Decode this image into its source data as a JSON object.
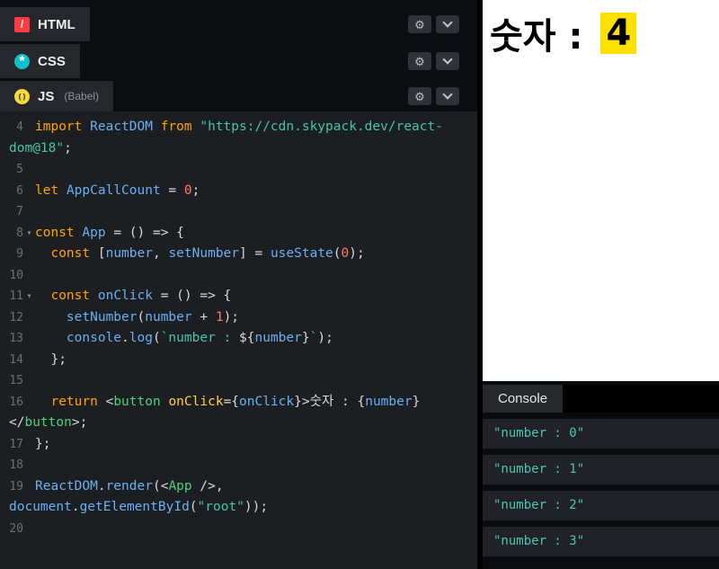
{
  "icons": {
    "gear": "⚙",
    "chevron_down": "css-shape",
    "fold_caret": "▾"
  },
  "colors": {
    "html_icon": "#ff3c41",
    "css_icon": "#13c0c9",
    "js_icon": "#f5d93b",
    "number_highlight": "#ffe000",
    "console_log_text": "#49c7b2",
    "editor_background": "#1d1e22"
  },
  "editor": {
    "panels": [
      {
        "label": "HTML",
        "glyph": "/"
      },
      {
        "label": "CSS",
        "glyph": "*"
      },
      {
        "label": "JS",
        "sublabel": "(Babel)",
        "glyph": "( )"
      }
    ],
    "code": [
      {
        "num": "4",
        "tokens": [
          {
            "t": "kw",
            "s": "import"
          },
          {
            "t": "pun",
            "s": " "
          },
          {
            "t": "var",
            "s": "ReactDOM"
          },
          {
            "t": "pun",
            "s": " "
          },
          {
            "t": "kw",
            "s": "from"
          },
          {
            "t": "pun",
            "s": " "
          },
          {
            "t": "str",
            "s": "\"https://cdn.skypack.dev/react-"
          }
        ]
      },
      {
        "num": "",
        "wrap": true,
        "tokens": [
          {
            "t": "str",
            "s": "dom@18\""
          },
          {
            "t": "pun",
            "s": ";"
          }
        ]
      },
      {
        "num": "5",
        "tokens": []
      },
      {
        "num": "6",
        "tokens": [
          {
            "t": "kw",
            "s": "let"
          },
          {
            "t": "pun",
            "s": " "
          },
          {
            "t": "var",
            "s": "AppCallCount"
          },
          {
            "t": "pun",
            "s": " = "
          },
          {
            "t": "num",
            "s": "0"
          },
          {
            "t": "pun",
            "s": ";"
          }
        ]
      },
      {
        "num": "7",
        "tokens": []
      },
      {
        "num": "8",
        "fold": true,
        "tokens": [
          {
            "t": "kw",
            "s": "const"
          },
          {
            "t": "pun",
            "s": " "
          },
          {
            "t": "var",
            "s": "App"
          },
          {
            "t": "pun",
            "s": " = () => {"
          }
        ]
      },
      {
        "num": "9",
        "tokens": [
          {
            "t": "pun",
            "s": "  "
          },
          {
            "t": "kw",
            "s": "const"
          },
          {
            "t": "pun",
            "s": " ["
          },
          {
            "t": "var",
            "s": "number"
          },
          {
            "t": "pun",
            "s": ", "
          },
          {
            "t": "var",
            "s": "setNumber"
          },
          {
            "t": "pun",
            "s": "] = "
          },
          {
            "t": "var",
            "s": "useState"
          },
          {
            "t": "pun",
            "s": "("
          },
          {
            "t": "num",
            "s": "0"
          },
          {
            "t": "pun",
            "s": ");"
          }
        ]
      },
      {
        "num": "10",
        "tokens": []
      },
      {
        "num": "11",
        "fold": true,
        "tokens": [
          {
            "t": "pun",
            "s": "  "
          },
          {
            "t": "kw",
            "s": "const"
          },
          {
            "t": "pun",
            "s": " "
          },
          {
            "t": "var",
            "s": "onClick"
          },
          {
            "t": "pun",
            "s": " = () => {"
          }
        ]
      },
      {
        "num": "12",
        "tokens": [
          {
            "t": "pun",
            "s": "    "
          },
          {
            "t": "var",
            "s": "setNumber"
          },
          {
            "t": "pun",
            "s": "("
          },
          {
            "t": "var",
            "s": "number"
          },
          {
            "t": "pun",
            "s": " + "
          },
          {
            "t": "num",
            "s": "1"
          },
          {
            "t": "pun",
            "s": ");"
          }
        ]
      },
      {
        "num": "13",
        "tokens": [
          {
            "t": "pun",
            "s": "    "
          },
          {
            "t": "var",
            "s": "console"
          },
          {
            "t": "pun",
            "s": "."
          },
          {
            "t": "var",
            "s": "log"
          },
          {
            "t": "pun",
            "s": "("
          },
          {
            "t": "str",
            "s": "`number : "
          },
          {
            "t": "pun",
            "s": "${"
          },
          {
            "t": "var",
            "s": "number"
          },
          {
            "t": "pun",
            "s": "}"
          },
          {
            "t": "str",
            "s": "`"
          },
          {
            "t": "pun",
            "s": ");"
          }
        ]
      },
      {
        "num": "14",
        "tokens": [
          {
            "t": "pun",
            "s": "  };"
          }
        ]
      },
      {
        "num": "15",
        "tokens": []
      },
      {
        "num": "16",
        "tokens": [
          {
            "t": "pun",
            "s": "  "
          },
          {
            "t": "kw",
            "s": "return"
          },
          {
            "t": "pun",
            "s": " <"
          },
          {
            "t": "tag",
            "s": "button"
          },
          {
            "t": "pun",
            "s": " "
          },
          {
            "t": "attr",
            "s": "onClick"
          },
          {
            "t": "pun",
            "s": "={"
          },
          {
            "t": "var",
            "s": "onClick"
          },
          {
            "t": "pun",
            "s": "}>"
          },
          {
            "t": "pun",
            "s": "숫자 : {"
          },
          {
            "t": "var",
            "s": "number"
          },
          {
            "t": "pun",
            "s": "}"
          }
        ]
      },
      {
        "num": "",
        "wrap": true,
        "tokens": [
          {
            "t": "pun",
            "s": "</"
          },
          {
            "t": "tag",
            "s": "button"
          },
          {
            "t": "pun",
            "s": ">;"
          }
        ]
      },
      {
        "num": "17",
        "tokens": [
          {
            "t": "pun",
            "s": "};"
          }
        ]
      },
      {
        "num": "18",
        "tokens": []
      },
      {
        "num": "19",
        "tokens": [
          {
            "t": "var",
            "s": "ReactDOM"
          },
          {
            "t": "pun",
            "s": "."
          },
          {
            "t": "var",
            "s": "render"
          },
          {
            "t": "pun",
            "s": "(<"
          },
          {
            "t": "tag",
            "s": "App"
          },
          {
            "t": "pun",
            "s": " />,"
          }
        ]
      },
      {
        "num": "",
        "wrap": true,
        "tokens": [
          {
            "t": "var",
            "s": "document"
          },
          {
            "t": "pun",
            "s": "."
          },
          {
            "t": "var",
            "s": "getElementById"
          },
          {
            "t": "pun",
            "s": "("
          },
          {
            "t": "str",
            "s": "\"root\""
          },
          {
            "t": "pun",
            "s": "));"
          }
        ]
      },
      {
        "num": "20",
        "tokens": []
      }
    ]
  },
  "preview": {
    "counter_prefix": "숫자 : ",
    "counter_value": "4"
  },
  "console": {
    "title": "Console",
    "logs": [
      "\"number : 0\"",
      "\"number : 1\"",
      "\"number : 2\"",
      "\"number : 3\""
    ]
  }
}
